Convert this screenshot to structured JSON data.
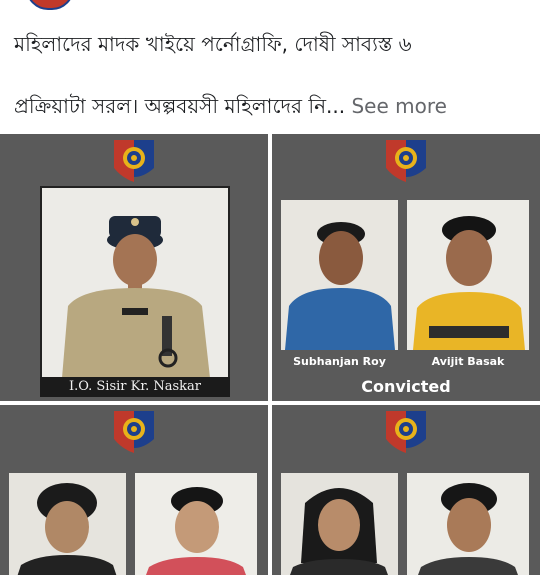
{
  "post": {
    "caption_line1": "মহিলাদের মাদক খাইয়ে পর্নোগ্রাফি, দোষী সাব্যস্ত ৬",
    "caption_line2": "প্রক্রিয়াটা সরল। অল্পবয়সী মহিলাদের নি...",
    "see_more": "See more"
  },
  "photos": {
    "investigator_label": "I.O. Sisir Kr. Naskar",
    "convict_1": "Subhanjan Roy",
    "convict_2": "Avijit Basak",
    "status": "Convicted"
  },
  "colors": {
    "panel_bg": "#5a5a5a",
    "badge_blue": "#1d3f8c",
    "badge_red": "#c0392b",
    "badge_gold": "#e8b21a"
  },
  "icons": {
    "badge": "police-emblem-icon"
  }
}
